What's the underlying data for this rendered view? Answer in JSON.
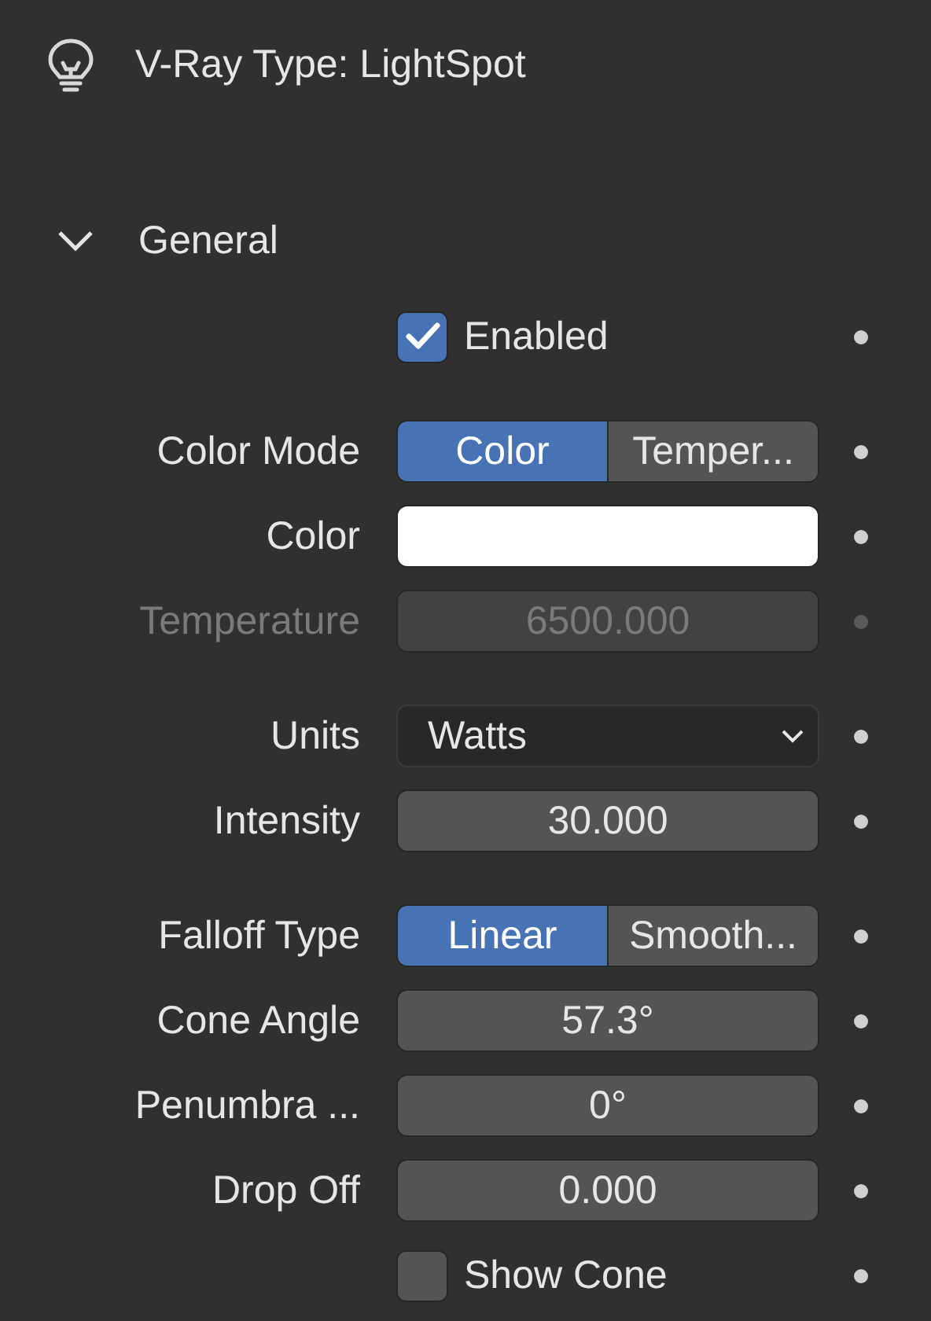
{
  "header": {
    "title": "V-Ray Type:  LightSpot"
  },
  "panel": {
    "title": "General",
    "expanded": true,
    "groups": [
      {
        "rows": [
          {
            "kind": "checkbox",
            "label": "Enabled",
            "checked": true,
            "disabled": false
          }
        ]
      },
      {
        "rows": [
          {
            "kind": "enum",
            "label": "Color Mode",
            "disabled": false,
            "options": [
              {
                "label": "Color",
                "selected": true
              },
              {
                "label": "Temper...",
                "selected": false
              }
            ]
          },
          {
            "kind": "color",
            "label": "Color",
            "color": "#ffffff",
            "disabled": false
          },
          {
            "kind": "number",
            "label": "Temperature",
            "value": "6500.000",
            "disabled": true
          }
        ]
      },
      {
        "rows": [
          {
            "kind": "dropdown",
            "label": "Units",
            "value": "Watts",
            "disabled": false
          },
          {
            "kind": "number",
            "label": "Intensity",
            "value": "30.000",
            "disabled": false
          }
        ]
      },
      {
        "rows": [
          {
            "kind": "enum",
            "label": "Falloff Type",
            "disabled": false,
            "options": [
              {
                "label": "Linear",
                "selected": true
              },
              {
                "label": "Smooth...",
                "selected": false
              }
            ]
          },
          {
            "kind": "number",
            "label": "Cone Angle",
            "value": "57.3°",
            "disabled": false
          },
          {
            "kind": "number",
            "label": "Penumbra ...",
            "value": "0°",
            "disabled": false
          },
          {
            "kind": "number",
            "label": "Drop Off",
            "value": "0.000",
            "disabled": false
          },
          {
            "kind": "checkbox",
            "label": "Show Cone",
            "checked": false,
            "disabled": false
          }
        ]
      }
    ]
  }
}
